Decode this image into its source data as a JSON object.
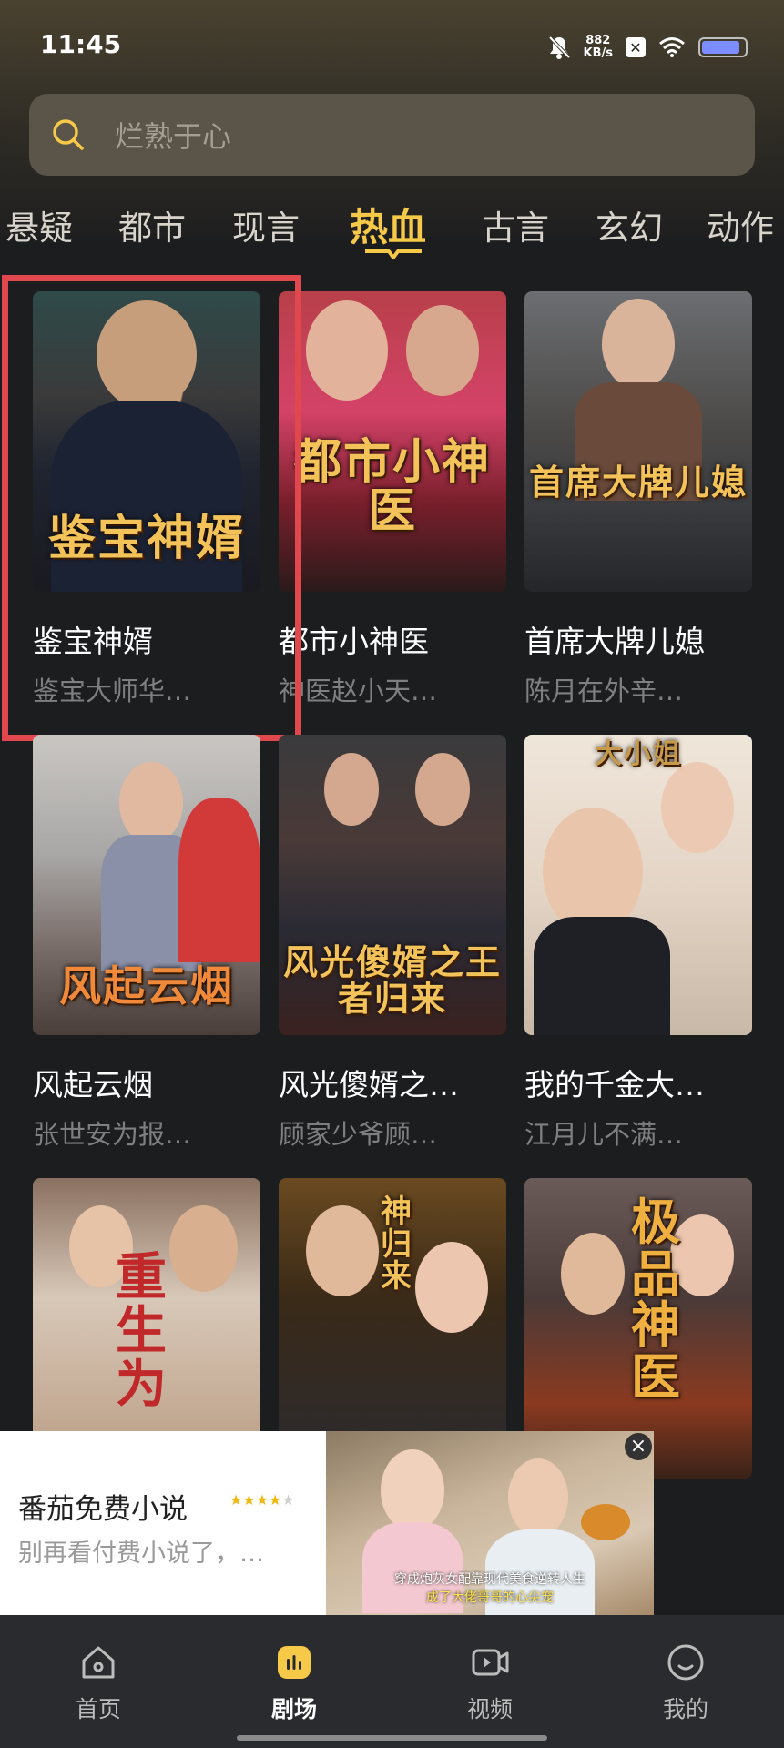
{
  "status_bar": {
    "time": "11:45",
    "net_speed_value": "882",
    "net_speed_unit": "KB/s"
  },
  "search": {
    "placeholder": "烂熟于心"
  },
  "categories": [
    "悬疑",
    "都市",
    "现言",
    "热血",
    "古言",
    "玄幻",
    "动作"
  ],
  "active_category": "热血",
  "dramas": [
    {
      "title": "鉴宝神婿",
      "subtitle": "鉴宝大师华…",
      "poster_text": "鉴宝神婿"
    },
    {
      "title": "都市小神医",
      "subtitle": "神医赵小天…",
      "poster_text": "都市小神医"
    },
    {
      "title": "首席大牌儿媳",
      "subtitle": "陈月在外辛…",
      "poster_text": "首席大牌儿媳"
    },
    {
      "title": "风起云烟",
      "subtitle": "张世安为报…",
      "poster_text": "风起云烟"
    },
    {
      "title": "风光傻婿之…",
      "subtitle": "顾家少爷顾…",
      "poster_text": "风光傻婿之王者归来"
    },
    {
      "title": "我的千金大…",
      "subtitle": "江月儿不满…",
      "poster_text": "大小姐"
    },
    {
      "title": "",
      "subtitle": "",
      "poster_text": "重生为"
    },
    {
      "title": "",
      "subtitle": "",
      "poster_text": "神归来"
    },
    {
      "title": "",
      "subtitle": "",
      "poster_text": "极品神医"
    }
  ],
  "ad": {
    "title": "番茄免费小说",
    "rating_stars": 4,
    "description": "别再看付费小说了，…",
    "caption_line1": "穿成炮灰女配靠现代美食逆转人生",
    "caption_line2": "成了大佬哥哥的心尖宠"
  },
  "bottom_nav": [
    {
      "label": "首页",
      "icon": "home-icon"
    },
    {
      "label": "剧场",
      "icon": "theater-icon"
    },
    {
      "label": "视频",
      "icon": "video-icon"
    },
    {
      "label": "我的",
      "icon": "profile-icon"
    }
  ],
  "colors": {
    "accent": "#f7c948",
    "background": "#1c1d1f",
    "highlight": "#e0484e"
  }
}
